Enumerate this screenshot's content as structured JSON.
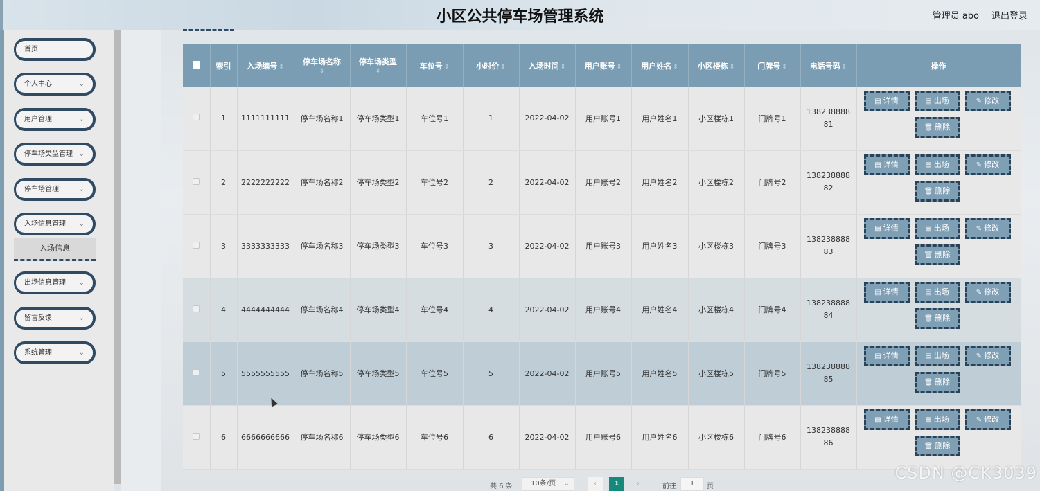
{
  "header": {
    "title": "小区公共停车场管理系统",
    "user": "管理员 abo",
    "logout": "退出登录"
  },
  "sidebar": {
    "items": [
      {
        "label": "首页",
        "has_arrow": false
      },
      {
        "label": "个人中心",
        "has_arrow": true
      },
      {
        "label": "用户管理",
        "has_arrow": true
      },
      {
        "label": "停车场类型管理",
        "has_arrow": true
      },
      {
        "label": "停车场管理",
        "has_arrow": true
      },
      {
        "label": "入场信息管理",
        "has_arrow": true
      },
      {
        "label": "出场信息管理",
        "has_arrow": true
      },
      {
        "label": "留言反馈",
        "has_arrow": true
      },
      {
        "label": "系统管理",
        "has_arrow": true
      }
    ],
    "active_sub": "入场信息"
  },
  "table": {
    "columns": [
      "索引",
      "入场编号",
      "停车场名称",
      "停车场类型",
      "车位号",
      "小时价",
      "入场时间",
      "用户账号",
      "用户姓名",
      "小区楼栋",
      "门牌号",
      "电话号码",
      "操作"
    ],
    "rows": [
      {
        "index": "1",
        "entry_no": "1111111111",
        "lot_name": "停车场名称1",
        "lot_type": "停车场类型1",
        "space": "车位号1",
        "price": "1",
        "time": "2022-04-02",
        "account": "用户账号1",
        "name": "用户姓名1",
        "building": "小区楼栋1",
        "door": "门牌号1",
        "phone_a": "138238888",
        "phone_b": "81"
      },
      {
        "index": "2",
        "entry_no": "2222222222",
        "lot_name": "停车场名称2",
        "lot_type": "停车场类型2",
        "space": "车位号2",
        "price": "2",
        "time": "2022-04-02",
        "account": "用户账号2",
        "name": "用户姓名2",
        "building": "小区楼栋2",
        "door": "门牌号2",
        "phone_a": "138238888",
        "phone_b": "82"
      },
      {
        "index": "3",
        "entry_no": "3333333333",
        "lot_name": "停车场名称3",
        "lot_type": "停车场类型3",
        "space": "车位号3",
        "price": "3",
        "time": "2022-04-02",
        "account": "用户账号3",
        "name": "用户姓名3",
        "building": "小区楼栋3",
        "door": "门牌号3",
        "phone_a": "138238888",
        "phone_b": "83"
      },
      {
        "index": "4",
        "entry_no": "4444444444",
        "lot_name": "停车场名称4",
        "lot_type": "停车场类型4",
        "space": "车位号4",
        "price": "4",
        "time": "2022-04-02",
        "account": "用户账号4",
        "name": "用户姓名4",
        "building": "小区楼栋4",
        "door": "门牌号4",
        "phone_a": "138238888",
        "phone_b": "84"
      },
      {
        "index": "5",
        "entry_no": "5555555555",
        "lot_name": "停车场名称5",
        "lot_type": "停车场类型5",
        "space": "车位号5",
        "price": "5",
        "time": "2022-04-02",
        "account": "用户账号5",
        "name": "用户姓名5",
        "building": "小区楼栋5",
        "door": "门牌号5",
        "phone_a": "138238888",
        "phone_b": "85"
      },
      {
        "index": "6",
        "entry_no": "6666666666",
        "lot_name": "停车场名称6",
        "lot_type": "停车场类型6",
        "space": "车位号6",
        "price": "6",
        "time": "2022-04-02",
        "account": "用户账号6",
        "name": "用户姓名6",
        "building": "小区楼栋6",
        "door": "门牌号6",
        "phone_a": "138238888",
        "phone_b": "86"
      }
    ],
    "actions": {
      "detail": "详情",
      "exit": "出场",
      "edit": "修改",
      "delete": "删除"
    }
  },
  "pager": {
    "total": "共 6 条",
    "page_size": "10条/页",
    "current_page": "1",
    "goto_label": "前往",
    "goto_value": "1",
    "page_unit": "页"
  },
  "watermark": "CSDN @CK3039",
  "colors": {
    "header_bg": "#7a9db3",
    "button_bg": "#7f9fb5",
    "button_border": "#2a4257",
    "pager_active": "#16897a"
  }
}
